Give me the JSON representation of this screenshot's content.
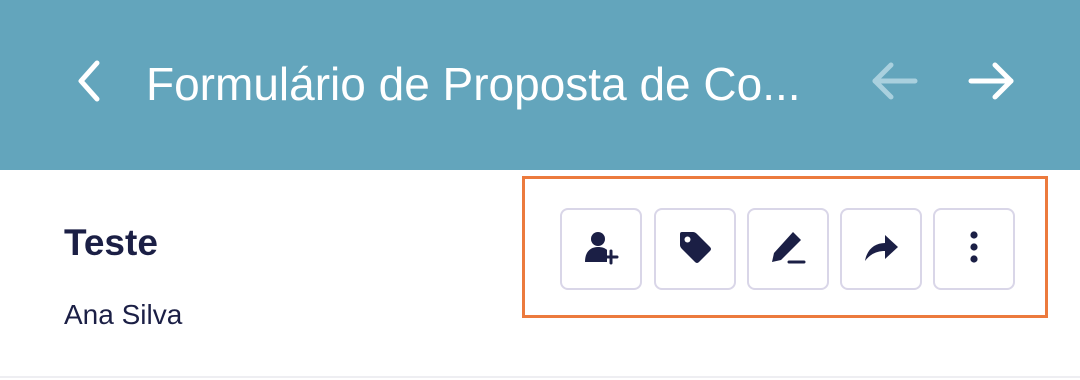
{
  "header": {
    "title": "Formulário de Proposta de Co...",
    "back_icon": "chevron-left-icon",
    "prev_icon": "arrow-left-icon",
    "next_icon": "arrow-right-icon",
    "background_color": "#63a5bc",
    "prev_enabled": false
  },
  "record": {
    "title": "Teste",
    "subtitle": "Ana Silva"
  },
  "actions": [
    {
      "icon": "add-user-icon"
    },
    {
      "icon": "tag-icon"
    },
    {
      "icon": "edit-icon"
    },
    {
      "icon": "share-icon"
    },
    {
      "icon": "more-vertical-icon"
    }
  ],
  "colors": {
    "highlight": "#ec7a3d",
    "text_dark": "#1b1f45",
    "button_border": "#d9d6e8"
  }
}
